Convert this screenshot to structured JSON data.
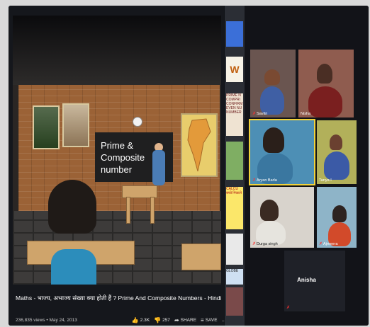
{
  "video": {
    "board_text": "Prime & Composite number",
    "title": "Maths - भाज्य, अभाज्य संख्या क्या होती हैं ? Prime And Composite Numbers - Hindi",
    "views_date": "236,835 views • May 24, 2013",
    "likes": "2.3K",
    "dislikes": "257",
    "share_label": "SHARE",
    "save_label": "SAVE",
    "more_label": "..."
  },
  "sidebar_thumbs": [
    {
      "text": ""
    },
    {
      "text": "W"
    },
    {
      "text": "PRIME N COMPRI CONFIRM EVEN NU NUMBER"
    },
    {
      "text": ""
    },
    {
      "text": "CALCU बच्चे निकाले"
    },
    {
      "text": ""
    },
    {
      "text": "GLOBE"
    },
    {
      "text": ""
    }
  ],
  "participants": [
    {
      "name": "Savitri"
    },
    {
      "name": "Nisha"
    },
    {
      "name": "Aryan Barla"
    },
    {
      "name": "Tanya I"
    },
    {
      "name": "Durga singh"
    },
    {
      "name": "Ajmeera"
    },
    {
      "name": "Anisha"
    }
  ],
  "colors": {
    "active_speaker": "#f2d23a",
    "muted_mic": "#ff3030"
  }
}
